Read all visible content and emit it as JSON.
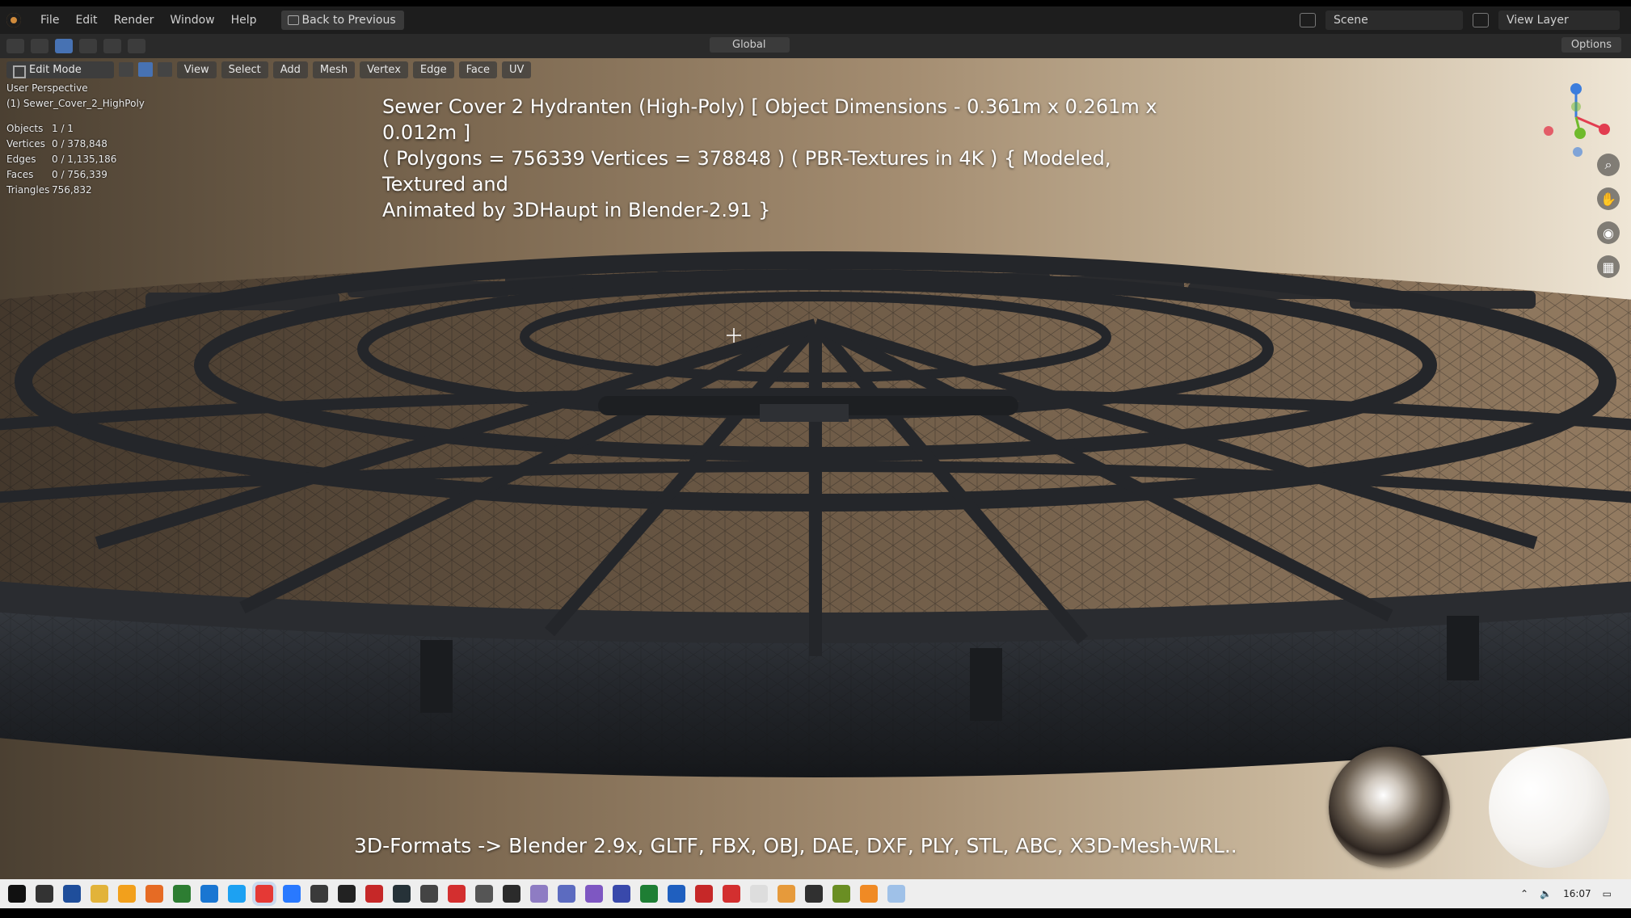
{
  "menubar": {
    "items": [
      "File",
      "Edit",
      "Render",
      "Window",
      "Help"
    ],
    "back_button": "Back to Previous",
    "scene_name": "Scene",
    "view_layer": "View Layer"
  },
  "toolbar": {
    "transform_orientation": "Global",
    "options_label": "Options"
  },
  "viewport": {
    "mode": "Edit Mode",
    "header_menus": [
      "View",
      "Select",
      "Add",
      "Mesh",
      "Vertex",
      "Edge",
      "Face",
      "UV"
    ],
    "perspective_label": "User Perspective",
    "active_object": "(1) Sewer_Cover_2_HighPoly",
    "stats": [
      {
        "label": "Objects",
        "value": "1 / 1"
      },
      {
        "label": "Vertices",
        "value": "0 / 378,848"
      },
      {
        "label": "Edges",
        "value": "0 / 1,135,186"
      },
      {
        "label": "Faces",
        "value": "0 / 756,339"
      },
      {
        "label": "Triangles",
        "value": "756,832"
      }
    ],
    "title_lines": [
      "Sewer Cover 2 Hydranten (High-Poly) [ Object Dimensions -  0.361m x 0.261m x 0.012m ]",
      "( Polygons = 756339 Vertices = 378848 ) ( PBR-Textures in 4K ) { Modeled, Textured and",
      "Animated by 3DHaupt in Blender-2.91 }"
    ],
    "formats_caption": "3D-Formats -> Blender 2.9x, GLTF, FBX, OBJ, DAE, DXF, PLY, STL, ABC, X3D-Mesh-WRL..",
    "nav_icons": [
      "zoom-icon",
      "hand-icon",
      "camera-icon",
      "grid-icon"
    ]
  },
  "taskbar": {
    "apps": [
      "windows-start",
      "search",
      "save",
      "folder",
      "paint",
      "firefox",
      "notes",
      "outlook",
      "skype",
      "chrome",
      "vscode",
      "steam",
      "unity",
      "davinci",
      "inkscape",
      "blender-dark",
      "office",
      "media",
      "obs",
      "photos",
      "calculator",
      "browser-2",
      "xbox",
      "excel",
      "word",
      "spark",
      "opera",
      "notepad",
      "sun",
      "terminal",
      "green-app",
      "blender",
      "files"
    ],
    "clock": "16:07",
    "colors": {
      "windows-start": "#111111",
      "search": "#333333",
      "save": "#1f4e9b",
      "folder": "#e2b33a",
      "paint": "#f2a01c",
      "firefox": "#e66b24",
      "notes": "#2d7d32",
      "outlook": "#1976d2",
      "skype": "#1da1f2",
      "chrome": "#e53935",
      "vscode": "#2979ff",
      "steam": "#3a3a3a",
      "unity": "#222222",
      "davinci": "#c62828",
      "inkscape": "#263238",
      "blender-dark": "#444444",
      "office": "#d32f2f",
      "media": "#555555",
      "obs": "#2b2b2b",
      "photos": "#8e7cc3",
      "calculator": "#5c6bc0",
      "browser-2": "#7e57c2",
      "xbox": "#3949ab",
      "excel": "#1e7e34",
      "word": "#1f5fbf",
      "spark": "#c62828",
      "opera": "#d32f2f",
      "notepad": "#dddddd",
      "sun": "#e69a3b",
      "terminal": "#303030",
      "green-app": "#6a8e23",
      "blender": "#f08a24",
      "files": "#9fc1e8"
    }
  }
}
